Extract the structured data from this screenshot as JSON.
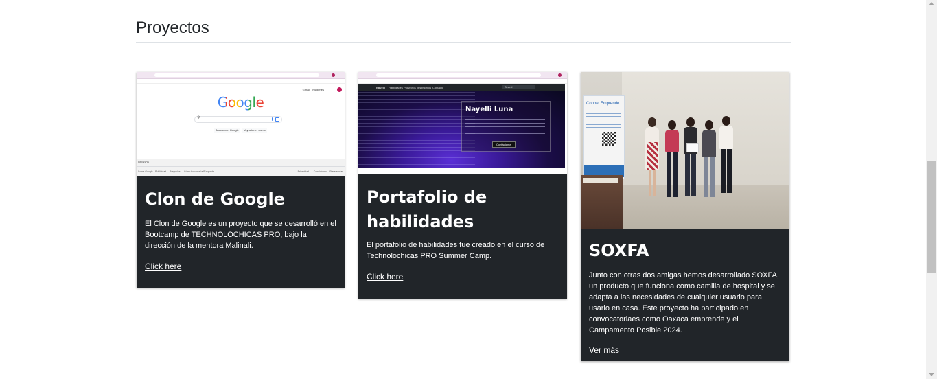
{
  "section": {
    "title": "Proyectos"
  },
  "cards": [
    {
      "title": "Clon de Google",
      "text": "El Clon de Google es un proyecto que se desarrolló en el Bootcamp de TECHNOLOCHICAS PRO, bajo la dirección de la mentora Malinali.",
      "link": "Click here",
      "thumb": {
        "logo": "Google",
        "btn1": "Buscar con Google",
        "btn2": "Voy a tener suerte",
        "footer_country": "México",
        "footer_left": [
          "Sobre Google",
          "Publicidad",
          "Negocios",
          "Cómo funciona la Búsqueda"
        ],
        "footer_right": [
          "Privacidad",
          "Condiciones",
          "Preferencias"
        ],
        "top_links": [
          "Gmail",
          "Imágenes"
        ]
      }
    },
    {
      "title": "Portafolio de habilidades",
      "text": "El portafolio de habilidades fue creado en el curso de Technolochicas PRO Summer Camp.",
      "link": "Click here",
      "thumb": {
        "brand": "Nayelli",
        "nav": [
          "Habilidades",
          "Proyectos",
          "Testimonios",
          "Contacto"
        ],
        "search": "Search",
        "hero_name": "Nayelli Luna",
        "cta": "Contáctame"
      }
    },
    {
      "title": "SOXFA",
      "text": "Junto con otras dos amigas hemos desarrollado SOXFA, un producto que funciona como camilla de hospital y se adapta a las necesidades de cualquier usuario para usarlo en casa. Este proyecto ha participado en convocatoriaes como Oaxaca emprende y el Campamento Posible 2024.",
      "link": "Ver más",
      "thumb": {
        "banner": "Coppel Emprende"
      }
    }
  ],
  "colors": {
    "card_bg": "#212529",
    "text": "#212529",
    "rule": "#dee2e6",
    "google_blue": "#4285f4",
    "google_red": "#ea4335",
    "google_yellow": "#fbbc05",
    "google_green": "#34a853"
  }
}
